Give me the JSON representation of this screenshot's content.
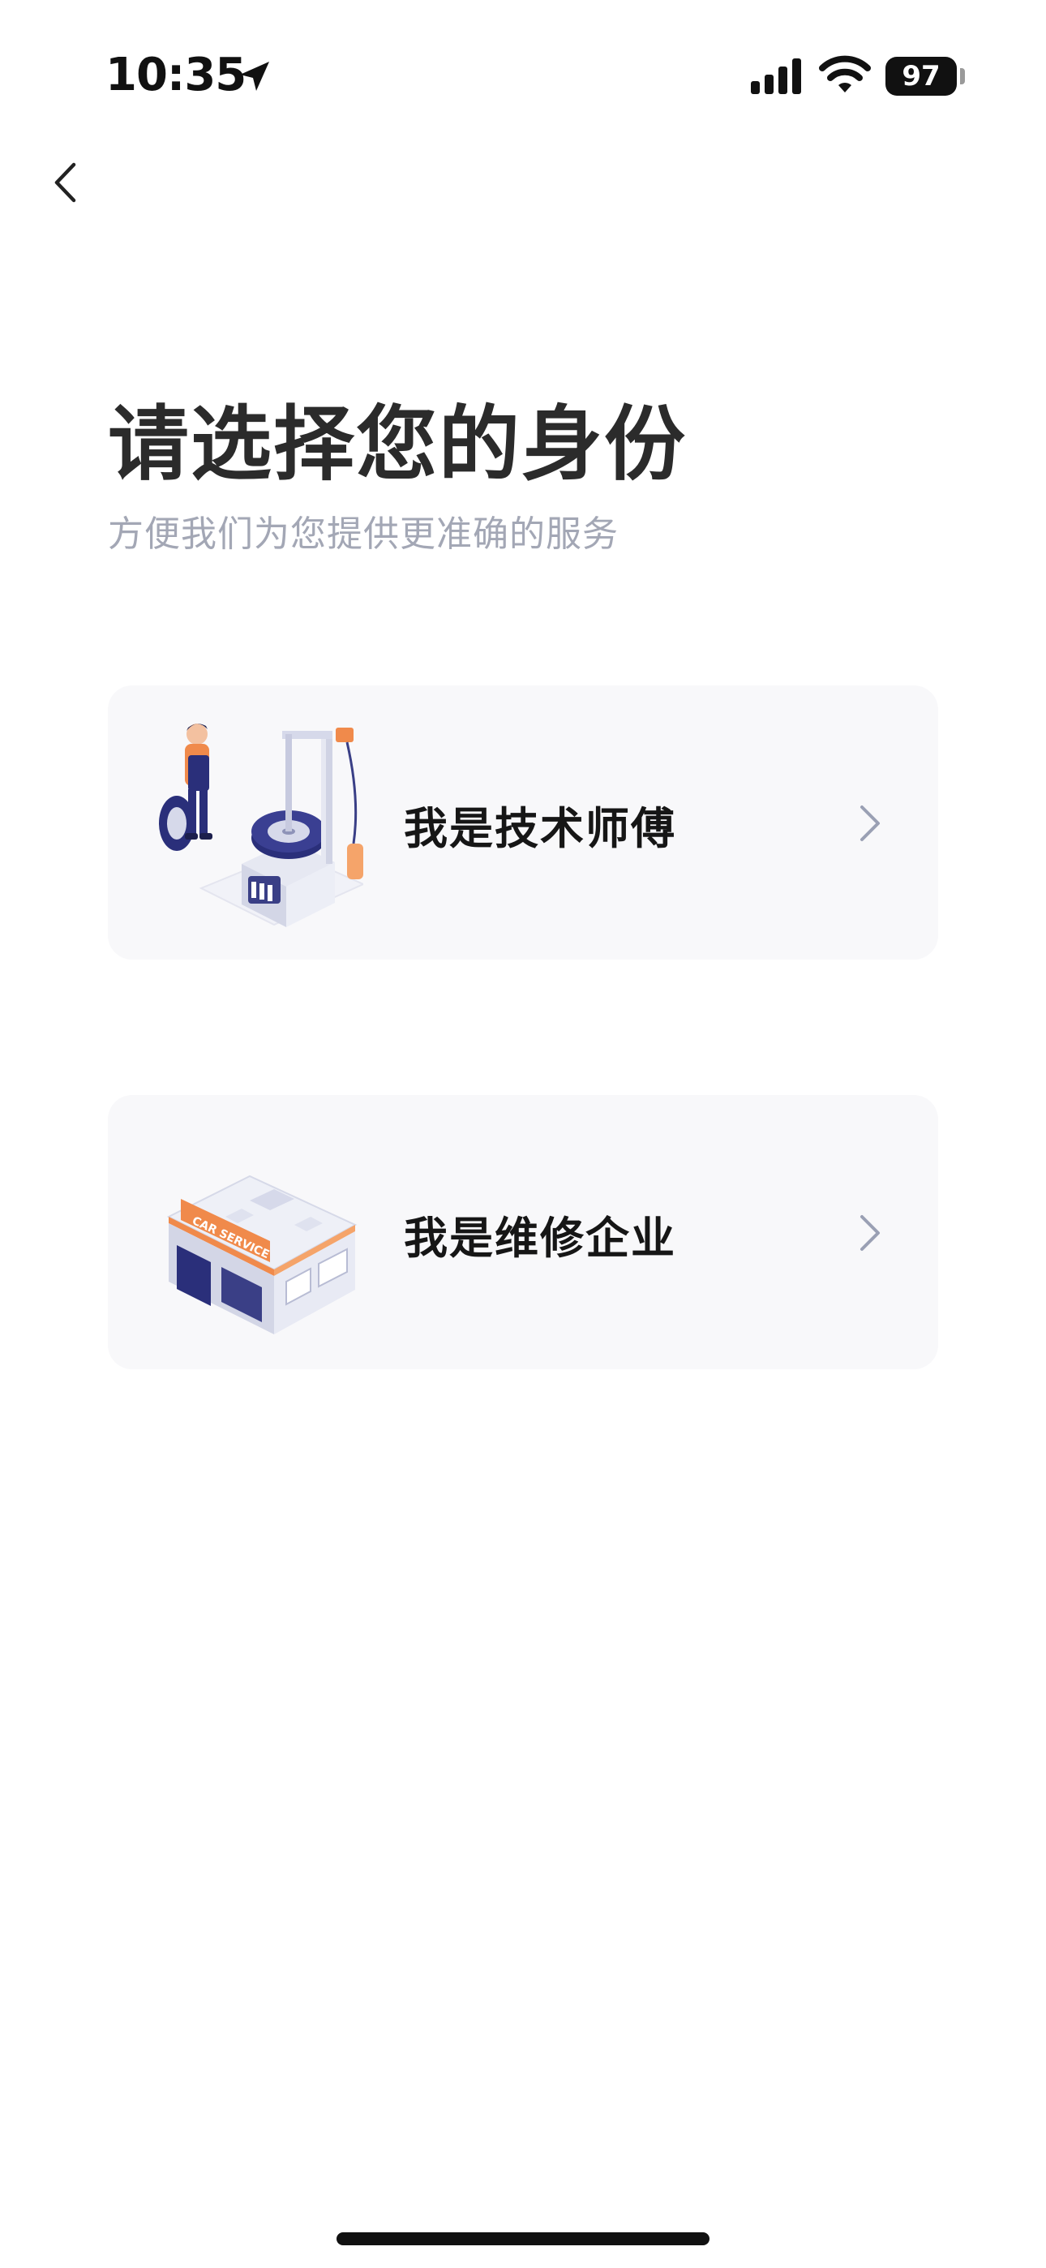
{
  "status_bar": {
    "time": "10:35",
    "battery": "97",
    "icons": [
      "location-arrow-icon",
      "cellular-signal-icon",
      "wifi-icon",
      "battery-icon"
    ]
  },
  "nav": {
    "back_icon": "chevron-left-icon"
  },
  "header": {
    "title": "请选择您的身份",
    "subtitle": "方便我们为您提供更准确的服务"
  },
  "roles": [
    {
      "label": "我是技术师傅",
      "illustration": "tire-technician-illustration",
      "icon": "chevron-right-icon"
    },
    {
      "label": "我是维修企业",
      "illustration": "car-service-shop-illustration",
      "icon": "chevron-right-icon"
    }
  ],
  "illustration_text": {
    "shop_sign": "CAR SERVICE"
  },
  "colors": {
    "title": "#2b2b2b",
    "subtitle": "#a3a7b5",
    "card_bg": "#f8f8fa",
    "chevron": "#9aa0b4",
    "accent_orange": "#f08a4b",
    "accent_navy": "#2a2f7a"
  }
}
